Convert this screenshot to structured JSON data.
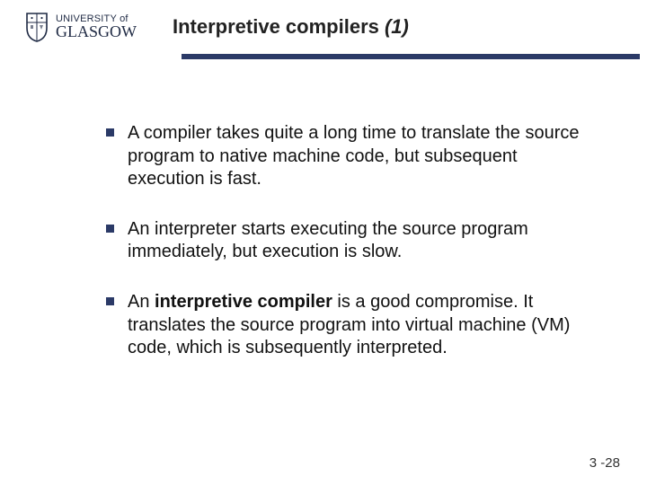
{
  "logo": {
    "top_line": "UNIVERSITY of",
    "bottom_line": "GLASGOW"
  },
  "title": {
    "main": "Interpretive compilers ",
    "suffix": "(1)"
  },
  "bullets": [
    {
      "pre": "A compiler takes quite a long time to translate the source program to native machine code, but subsequent execution is fast.",
      "bold": "",
      "post": ""
    },
    {
      "pre": "An interpreter starts executing the source program immediately, but execution is slow.",
      "bold": "",
      "post": ""
    },
    {
      "pre": "An ",
      "bold": "interpretive compiler",
      "post": " is a good compromise. It translates the source program into virtual machine (VM) code, which is subsequently interpreted."
    }
  ],
  "page_number": "3 -28",
  "colors": {
    "accent": "#2b3a67"
  }
}
